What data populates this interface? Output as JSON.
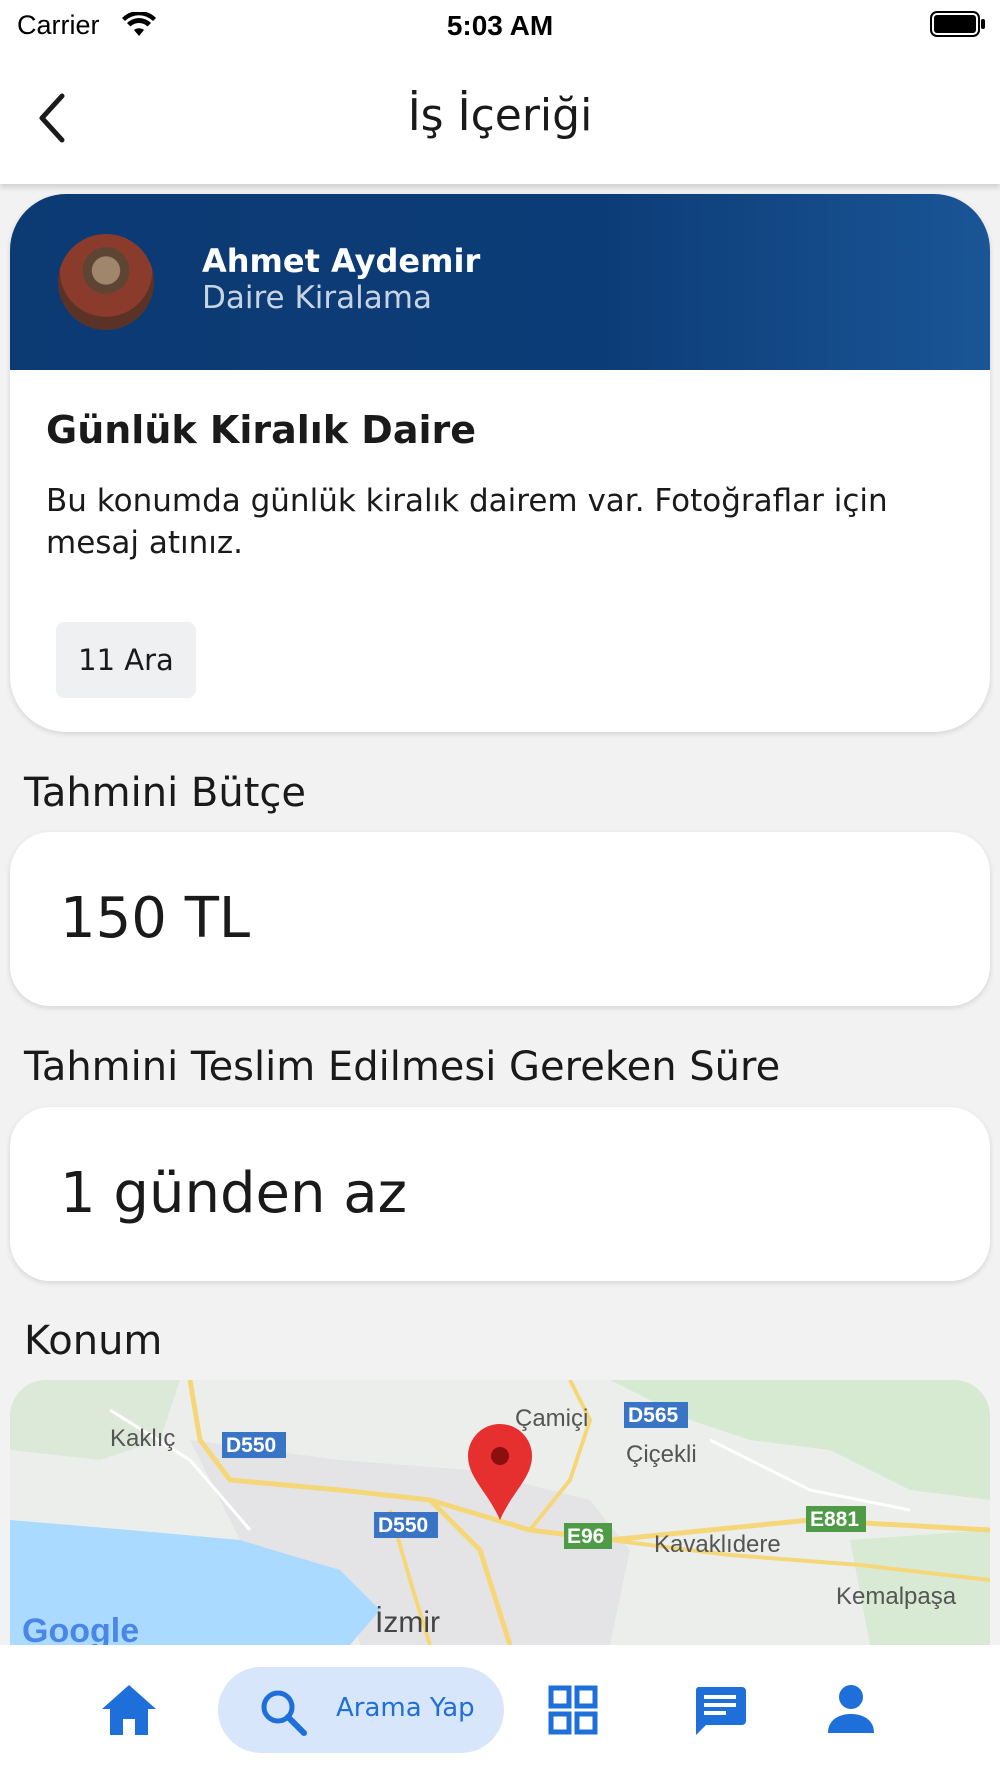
{
  "status_bar": {
    "carrier": "Carrier",
    "time": "5:03 AM"
  },
  "nav": {
    "title": "İş İçeriği"
  },
  "job": {
    "user_name": "Ahmet Aydemir",
    "category": "Daire Kiralama",
    "title": "Günlük Kiralık Daire",
    "description": "Bu konumda günlük kiralık dairem var. Fotoğraflar için mesaj atınız.",
    "date": "11 Ara"
  },
  "budget": {
    "label": "Tahmini Bütçe",
    "value": "150 TL"
  },
  "duration": {
    "label": "Tahmini Teslim Edilmesi Gereken Süre",
    "value": "1 günden az"
  },
  "location": {
    "label": "Konum",
    "map_labels": {
      "camici": "Çamiçi",
      "cicekli": "Çiçekli",
      "kaklic": "Kaklıç",
      "kavaklidere": "Kavaklıdere",
      "kemalpasa": "Kemalpaşa",
      "izmir": "İzmir",
      "d550a": "D550",
      "d550b": "D550",
      "d565": "D565",
      "e96": "E96",
      "e881": "E881",
      "google": "Google"
    }
  },
  "tabbar": {
    "search_label": "Arama Yap"
  },
  "colors": {
    "accent": "#1e6fd9",
    "header": "#0c3a73"
  }
}
